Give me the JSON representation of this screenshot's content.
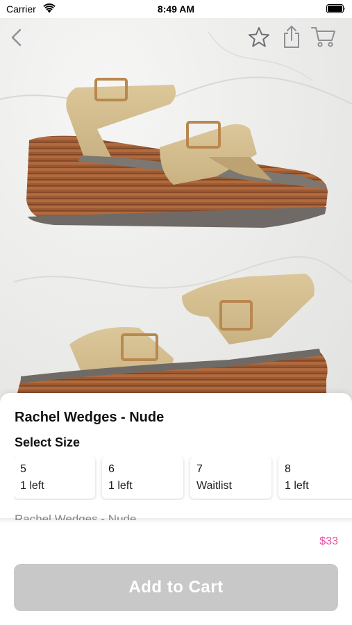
{
  "status_bar": {
    "carrier": "Carrier",
    "time": "8:49 AM",
    "wifi_icon": "wifi-icon",
    "battery_icon": "battery-full-icon"
  },
  "nav": {
    "back_icon": "chevron-left-icon",
    "favorite_icon": "star-outline-icon",
    "share_icon": "share-icon",
    "cart_icon": "cart-icon"
  },
  "product": {
    "title": "Rachel Wedges - Nude",
    "image": "wedge-sandals-photo",
    "description_preview": "Rachel Wedges - Nude",
    "price": "$33"
  },
  "size_section": {
    "heading": "Select Size",
    "sizes": [
      {
        "size": "5",
        "stock": "1 left"
      },
      {
        "size": "6",
        "stock": "1 left"
      },
      {
        "size": "7",
        "stock": "Waitlist"
      },
      {
        "size": "8",
        "stock": "1 left"
      }
    ]
  },
  "actions": {
    "add_to_cart_label": "Add to Cart"
  },
  "colors": {
    "price": "#ec4ea0",
    "button_disabled": "#c8c8c8",
    "icon_gray": "#8e8e93"
  }
}
